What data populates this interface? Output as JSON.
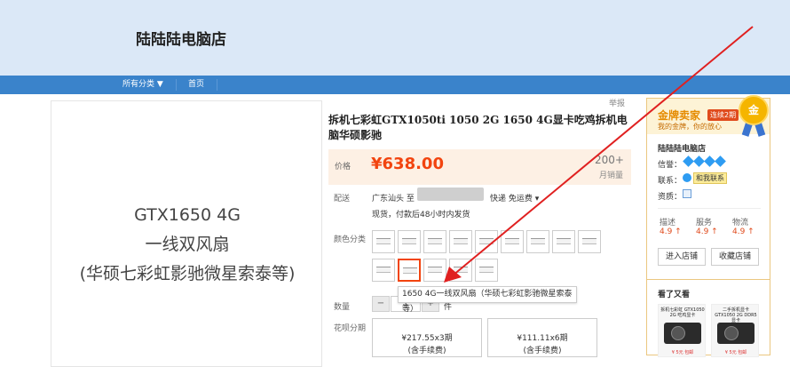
{
  "header": {
    "shop_name": "陆陆陆电脑店"
  },
  "nav": {
    "all_categories": "所有分类 ▼",
    "home": "首页"
  },
  "product_image": {
    "line1": "GTX1650 4G",
    "line2": "一线双风扇",
    "line3": "(华硕七彩虹影驰微星索泰等)"
  },
  "report_label": "举报",
  "product": {
    "title": "拆机七彩虹GTX1050ti 1050 2G 1650 4G显卡吃鸡拆机电脑华硕影驰",
    "price_label": "价格",
    "price": "¥638.00",
    "sold_count": "200+",
    "sold_label": "月销量",
    "shipping_label": "配送",
    "ship_from": "广东汕头 至",
    "shipping_option": "快递 免运费 ▾",
    "shipping_note": "现货，付款后48小时内发货",
    "color_label": "颜色分类",
    "tooltip": "1650 4G一线双风扇（华硕七彩虹影驰微星索泰等）",
    "qty_label": "数量",
    "qty_value": "1",
    "qty_unit": "件",
    "minus": "−",
    "plus": "+",
    "installments_label": "花呗分期",
    "installments": [
      {
        "price": "¥217.55x3期",
        "fee": "(含手续费)"
      },
      {
        "price": "¥111.11x6期",
        "fee": "(含手续费)"
      }
    ]
  },
  "seller": {
    "gold_title": "金牌卖家",
    "gold_badge": "连续2期",
    "gold_sub": "我的金牌，你的放心",
    "medal": "金",
    "shop_name": "陆陆陆电脑店",
    "credit_label": "信誉：",
    "contact_label": "联系：",
    "contact_btn": "和我联系",
    "qualification_label": "资质：",
    "ratings": [
      {
        "label": "描述",
        "value": "4.9 ↑"
      },
      {
        "label": "服务",
        "value": "4.9 ↑"
      },
      {
        "label": "物流",
        "value": "4.9 ↑"
      }
    ],
    "enter_shop": "进入店铺",
    "favorite_shop": "收藏店铺",
    "also_viewed": "看了又看",
    "thumbs": [
      {
        "caption": "拆机七彩虹 GTX1050 2G 吃鸡显卡",
        "note": "¥ 5元 包邮"
      },
      {
        "caption": "二手拆机显卡 GTX1050 2G DDR5显卡",
        "note": "¥ 5元 包邮"
      }
    ]
  },
  "colors": {
    "accent": "#f2440f",
    "nav": "#3a83cb",
    "header_bg": "#dbe8f7",
    "arrow": "#e02020"
  }
}
